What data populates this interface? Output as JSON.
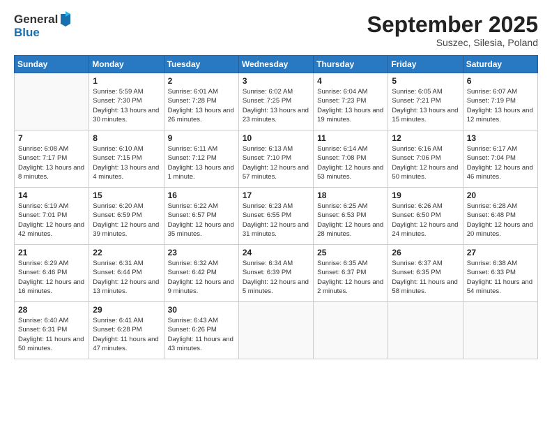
{
  "header": {
    "logo": {
      "general": "General",
      "blue": "Blue"
    },
    "title": "September 2025",
    "location": "Suszec, Silesia, Poland"
  },
  "calendar": {
    "weekdays": [
      "Sunday",
      "Monday",
      "Tuesday",
      "Wednesday",
      "Thursday",
      "Friday",
      "Saturday"
    ],
    "weeks": [
      [
        {
          "day": "",
          "sunrise": "",
          "sunset": "",
          "daylight": "",
          "empty": true
        },
        {
          "day": "1",
          "sunrise": "Sunrise: 5:59 AM",
          "sunset": "Sunset: 7:30 PM",
          "daylight": "Daylight: 13 hours and 30 minutes.",
          "empty": false
        },
        {
          "day": "2",
          "sunrise": "Sunrise: 6:01 AM",
          "sunset": "Sunset: 7:28 PM",
          "daylight": "Daylight: 13 hours and 26 minutes.",
          "empty": false
        },
        {
          "day": "3",
          "sunrise": "Sunrise: 6:02 AM",
          "sunset": "Sunset: 7:25 PM",
          "daylight": "Daylight: 13 hours and 23 minutes.",
          "empty": false
        },
        {
          "day": "4",
          "sunrise": "Sunrise: 6:04 AM",
          "sunset": "Sunset: 7:23 PM",
          "daylight": "Daylight: 13 hours and 19 minutes.",
          "empty": false
        },
        {
          "day": "5",
          "sunrise": "Sunrise: 6:05 AM",
          "sunset": "Sunset: 7:21 PM",
          "daylight": "Daylight: 13 hours and 15 minutes.",
          "empty": false
        },
        {
          "day": "6",
          "sunrise": "Sunrise: 6:07 AM",
          "sunset": "Sunset: 7:19 PM",
          "daylight": "Daylight: 13 hours and 12 minutes.",
          "empty": false
        }
      ],
      [
        {
          "day": "7",
          "sunrise": "Sunrise: 6:08 AM",
          "sunset": "Sunset: 7:17 PM",
          "daylight": "Daylight: 13 hours and 8 minutes.",
          "empty": false
        },
        {
          "day": "8",
          "sunrise": "Sunrise: 6:10 AM",
          "sunset": "Sunset: 7:15 PM",
          "daylight": "Daylight: 13 hours and 4 minutes.",
          "empty": false
        },
        {
          "day": "9",
          "sunrise": "Sunrise: 6:11 AM",
          "sunset": "Sunset: 7:12 PM",
          "daylight": "Daylight: 13 hours and 1 minute.",
          "empty": false
        },
        {
          "day": "10",
          "sunrise": "Sunrise: 6:13 AM",
          "sunset": "Sunset: 7:10 PM",
          "daylight": "Daylight: 12 hours and 57 minutes.",
          "empty": false
        },
        {
          "day": "11",
          "sunrise": "Sunrise: 6:14 AM",
          "sunset": "Sunset: 7:08 PM",
          "daylight": "Daylight: 12 hours and 53 minutes.",
          "empty": false
        },
        {
          "day": "12",
          "sunrise": "Sunrise: 6:16 AM",
          "sunset": "Sunset: 7:06 PM",
          "daylight": "Daylight: 12 hours and 50 minutes.",
          "empty": false
        },
        {
          "day": "13",
          "sunrise": "Sunrise: 6:17 AM",
          "sunset": "Sunset: 7:04 PM",
          "daylight": "Daylight: 12 hours and 46 minutes.",
          "empty": false
        }
      ],
      [
        {
          "day": "14",
          "sunrise": "Sunrise: 6:19 AM",
          "sunset": "Sunset: 7:01 PM",
          "daylight": "Daylight: 12 hours and 42 minutes.",
          "empty": false
        },
        {
          "day": "15",
          "sunrise": "Sunrise: 6:20 AM",
          "sunset": "Sunset: 6:59 PM",
          "daylight": "Daylight: 12 hours and 39 minutes.",
          "empty": false
        },
        {
          "day": "16",
          "sunrise": "Sunrise: 6:22 AM",
          "sunset": "Sunset: 6:57 PM",
          "daylight": "Daylight: 12 hours and 35 minutes.",
          "empty": false
        },
        {
          "day": "17",
          "sunrise": "Sunrise: 6:23 AM",
          "sunset": "Sunset: 6:55 PM",
          "daylight": "Daylight: 12 hours and 31 minutes.",
          "empty": false
        },
        {
          "day": "18",
          "sunrise": "Sunrise: 6:25 AM",
          "sunset": "Sunset: 6:53 PM",
          "daylight": "Daylight: 12 hours and 28 minutes.",
          "empty": false
        },
        {
          "day": "19",
          "sunrise": "Sunrise: 6:26 AM",
          "sunset": "Sunset: 6:50 PM",
          "daylight": "Daylight: 12 hours and 24 minutes.",
          "empty": false
        },
        {
          "day": "20",
          "sunrise": "Sunrise: 6:28 AM",
          "sunset": "Sunset: 6:48 PM",
          "daylight": "Daylight: 12 hours and 20 minutes.",
          "empty": false
        }
      ],
      [
        {
          "day": "21",
          "sunrise": "Sunrise: 6:29 AM",
          "sunset": "Sunset: 6:46 PM",
          "daylight": "Daylight: 12 hours and 16 minutes.",
          "empty": false
        },
        {
          "day": "22",
          "sunrise": "Sunrise: 6:31 AM",
          "sunset": "Sunset: 6:44 PM",
          "daylight": "Daylight: 12 hours and 13 minutes.",
          "empty": false
        },
        {
          "day": "23",
          "sunrise": "Sunrise: 6:32 AM",
          "sunset": "Sunset: 6:42 PM",
          "daylight": "Daylight: 12 hours and 9 minutes.",
          "empty": false
        },
        {
          "day": "24",
          "sunrise": "Sunrise: 6:34 AM",
          "sunset": "Sunset: 6:39 PM",
          "daylight": "Daylight: 12 hours and 5 minutes.",
          "empty": false
        },
        {
          "day": "25",
          "sunrise": "Sunrise: 6:35 AM",
          "sunset": "Sunset: 6:37 PM",
          "daylight": "Daylight: 12 hours and 2 minutes.",
          "empty": false
        },
        {
          "day": "26",
          "sunrise": "Sunrise: 6:37 AM",
          "sunset": "Sunset: 6:35 PM",
          "daylight": "Daylight: 11 hours and 58 minutes.",
          "empty": false
        },
        {
          "day": "27",
          "sunrise": "Sunrise: 6:38 AM",
          "sunset": "Sunset: 6:33 PM",
          "daylight": "Daylight: 11 hours and 54 minutes.",
          "empty": false
        }
      ],
      [
        {
          "day": "28",
          "sunrise": "Sunrise: 6:40 AM",
          "sunset": "Sunset: 6:31 PM",
          "daylight": "Daylight: 11 hours and 50 minutes.",
          "empty": false
        },
        {
          "day": "29",
          "sunrise": "Sunrise: 6:41 AM",
          "sunset": "Sunset: 6:28 PM",
          "daylight": "Daylight: 11 hours and 47 minutes.",
          "empty": false
        },
        {
          "day": "30",
          "sunrise": "Sunrise: 6:43 AM",
          "sunset": "Sunset: 6:26 PM",
          "daylight": "Daylight: 11 hours and 43 minutes.",
          "empty": false
        },
        {
          "day": "",
          "sunrise": "",
          "sunset": "",
          "daylight": "",
          "empty": true
        },
        {
          "day": "",
          "sunrise": "",
          "sunset": "",
          "daylight": "",
          "empty": true
        },
        {
          "day": "",
          "sunrise": "",
          "sunset": "",
          "daylight": "",
          "empty": true
        },
        {
          "day": "",
          "sunrise": "",
          "sunset": "",
          "daylight": "",
          "empty": true
        }
      ]
    ]
  }
}
